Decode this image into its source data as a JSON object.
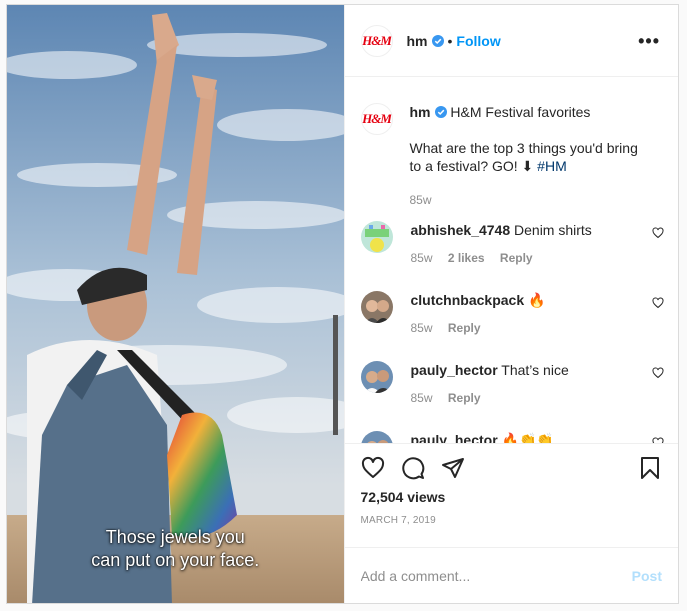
{
  "post": {
    "username": "hm",
    "brand_logo": "H&M",
    "follow_label": "Follow",
    "separator": "•",
    "more_label": "•••",
    "video_caption_line1": "Those jewels you",
    "video_caption_line2": "can put on your face.",
    "caption": {
      "title": "H&M Festival favorites",
      "question": "What are the top 3 things you'd bring to a festival? GO! ⬇ ",
      "hashtag": "#HM",
      "age": "85w"
    },
    "comments": [
      {
        "username": "abhishek_4748",
        "text": "Denim shirts",
        "age": "85w",
        "likes": "2 likes",
        "reply": "Reply"
      },
      {
        "username": "clutchnbackpack",
        "text": "🔥",
        "age": "85w",
        "reply": "Reply"
      },
      {
        "username": "pauly_hector",
        "text": "That’s nice",
        "age": "85w",
        "reply": "Reply"
      },
      {
        "username": "pauly_hector",
        "text": "🔥👏👏"
      }
    ],
    "views": "72,504 views",
    "date": "MARCH 7, 2019",
    "comment_placeholder": "Add a comment...",
    "post_label": "Post"
  },
  "colors": {
    "accent": "#0095f6",
    "brand": "#e50010",
    "muted": "#8e8e8e"
  },
  "icons": [
    "verified-icon",
    "more-icon",
    "heart-icon",
    "comment-icon",
    "share-icon",
    "save-icon"
  ]
}
